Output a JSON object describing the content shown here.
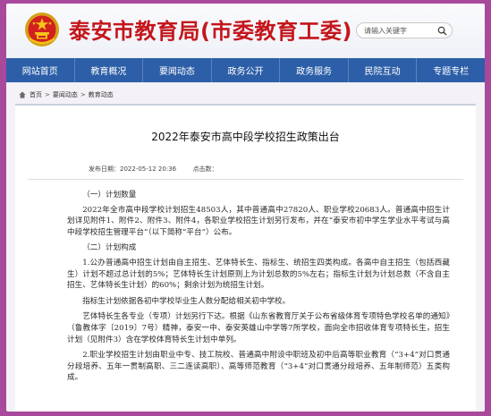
{
  "site": {
    "title": "泰安市教育局(市委教育工委)",
    "emblem_icon": "national-emblem-icon",
    "brand_color": "#c4161c"
  },
  "search": {
    "placeholder": "请输入关键字",
    "icon": "search-icon"
  },
  "nav": {
    "color": "#2d5fa8",
    "items": [
      "网站首页",
      "教育概况",
      "要闻动态",
      "政务公开",
      "政务服务",
      "民院互动",
      "专题专栏"
    ]
  },
  "breadcrumb": {
    "home": "首页",
    "sep": ">",
    "level1": "要闻动态",
    "level2": "教育动态"
  },
  "article": {
    "title": "2022年泰安市高中段学校招生政策出台",
    "meta": {
      "date_label": "发布日期：2022-05-12 20:36",
      "views_label": "点击数："
    },
    "paragraphs": [
      "（一）计划数量",
      "2022年全市高中段学校计划招生48503人，其中普通高中27820人、职业学校20683人。普通高中招生计划详见附件1、附件2、附件3、附件4，各职业学校招生计划另行发布，并在“泰安市初中学生学业水平考试与高中段学校招生管理平台”（以下简称“平台”）公布。",
      "（二）计划构成",
      "1.公办普通高中招生计划由自主招生、艺体特长生、指标生、统招生四类构成。各高中自主招生（包括西藏生）计划不超过总计划的5%；艺体特长生计划原则上为计划总数的5%左右；指标生计划为计划总数（不含自主招生、艺体特长生计划）的60%；剩余计划为统招生计划。",
      "指标生计划依据各初中学校毕业生人数分配给相关初中学校。",
      "艺体特长生各专业（专项）计划另行下达。根据《山东省教育厅关于公布省级体育专项特色学校名单的通知》（鲁教体字〔2019〕7号）精神，泰安一中、泰安英雄山中学等7所学校，面向全市招收体育专项特长生，招生计划（见附件3）含在学校体育特长生计划中单列。",
      "2.职业学校招生计划由职业中专、技工院校、普通高中附设中职班及初中后高等职业教育（“3+4”对口贯通分段培养、五年一贯制高职、三二连读高职）、高等师范教育（“3+4”对口贯通分段培养、五年制师范）五类构成。"
    ]
  }
}
